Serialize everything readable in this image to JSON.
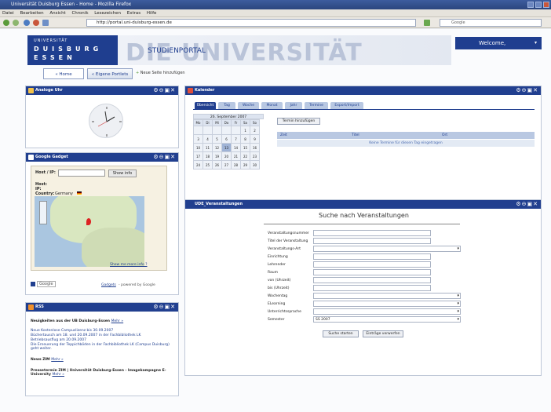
{
  "browser": {
    "title": "Universität Duisburg Essen - Home - Mozilla Firefox",
    "menu": [
      "Datei",
      "Bearbeiten",
      "Ansicht",
      "Chronik",
      "Lesezeichen",
      "Extras",
      "Hilfe"
    ],
    "url": "http://portal.uni-duisburg-essen.de",
    "search_placeholder": "Google"
  },
  "header": {
    "logo_small": "UNIVERSITÄT",
    "logo_line1": "DUISBURG",
    "logo_line2": "ESSEN",
    "portal_label": "STUDIENPORTAL",
    "watermark": "DIE UNIVERSITÄT",
    "welcome": "Welcome,"
  },
  "page_tabs": {
    "home": "« Home",
    "eigene": "« Eigene Portlets",
    "add": "Neue Seite hinzufügen"
  },
  "clock_portlet": {
    "title": "Analoge Uhr"
  },
  "gadget_portlet": {
    "title": "Google Gadget",
    "host_label": "Host / IP:",
    "button": "Show info",
    "info_host": "Host:",
    "info_ip": "IP:",
    "info_country": "Country:",
    "country_value": "Germany",
    "map_footer": "Show me more info ?",
    "google_label": "Google",
    "footer_link": "Gadgets",
    "footer_powered": "- powered by Google"
  },
  "rss_portlet": {
    "title": "RSS",
    "heading1": "Neuigkeiten aus der UB Duisburg-Essen",
    "more1": "Mehr »",
    "items": [
      "Neue Kostenlose Campuslizenz bis 30.09.2007",
      "Büchertausch am 18. und 20.09.2007 in der Fachbibliothek LK",
      "Betriebsausflug am 20.09.2007",
      "Die Erneuerung der Teppichböden in der Fachbibliothek LK (Campus Duisburg) geht weiter."
    ],
    "heading2": "News ZIM",
    "more2": "Mehr »",
    "heading3": "Pressetermin ZIM | Universität Duisburg-Essen - Imagekampagne E-University",
    "more3": "Mehr »"
  },
  "calendar_portlet": {
    "title": "Kalender",
    "tabs": [
      "Übersicht",
      "Tag",
      "Woche",
      "Monat",
      "Jahr",
      "Termine",
      "Export/Import"
    ],
    "month_title": "26. September 2007",
    "weekdays": [
      "Mo",
      "Di",
      "Mi",
      "Do",
      "Fr",
      "Sa",
      "So"
    ],
    "weeks": [
      [
        "",
        "",
        "",
        "",
        "",
        "1",
        "2"
      ],
      [
        "3",
        "4",
        "5",
        "6",
        "7",
        "8",
        "9"
      ],
      [
        "10",
        "11",
        "12",
        "13",
        "14",
        "15",
        "16"
      ],
      [
        "17",
        "18",
        "19",
        "20",
        "21",
        "22",
        "23"
      ],
      [
        "24",
        "25",
        "26",
        "27",
        "28",
        "29",
        "30"
      ]
    ],
    "add_button": "Termin hinzufügen",
    "col_zeit": "Zeit",
    "col_titel": "Titel",
    "col_ort": "Ort",
    "empty_message": "Keine Termine für diesen Tag eingetragen"
  },
  "search_portlet": {
    "title": "UDE_Veranstaltungen",
    "heading": "Suche nach Veranstaltungen",
    "fields": [
      {
        "label": "Veranstaltungsnummer",
        "value": ""
      },
      {
        "label": "Titel der Veranstaltung",
        "value": ""
      },
      {
        "label": "Veranstaltungs-Art",
        "value": ""
      },
      {
        "label": "Einrichtung",
        "value": ""
      },
      {
        "label": "Lehrender",
        "value": ""
      },
      {
        "label": "Raum",
        "value": ""
      },
      {
        "label": "von (Uhrzeit)",
        "value": ""
      },
      {
        "label": "bis (Uhrzeit)",
        "value": ""
      },
      {
        "label": "Wochentag",
        "value": ""
      },
      {
        "label": "ELearning",
        "value": ""
      },
      {
        "label": "Unterrichtssprache",
        "value": ""
      },
      {
        "label": "Semester",
        "value": "SS 2007"
      }
    ],
    "search_button": "Suche starten",
    "reset_button": "Einträge verwerfen"
  },
  "colors": {
    "brand": "#213f8f",
    "tab": "#b9c8e2"
  }
}
